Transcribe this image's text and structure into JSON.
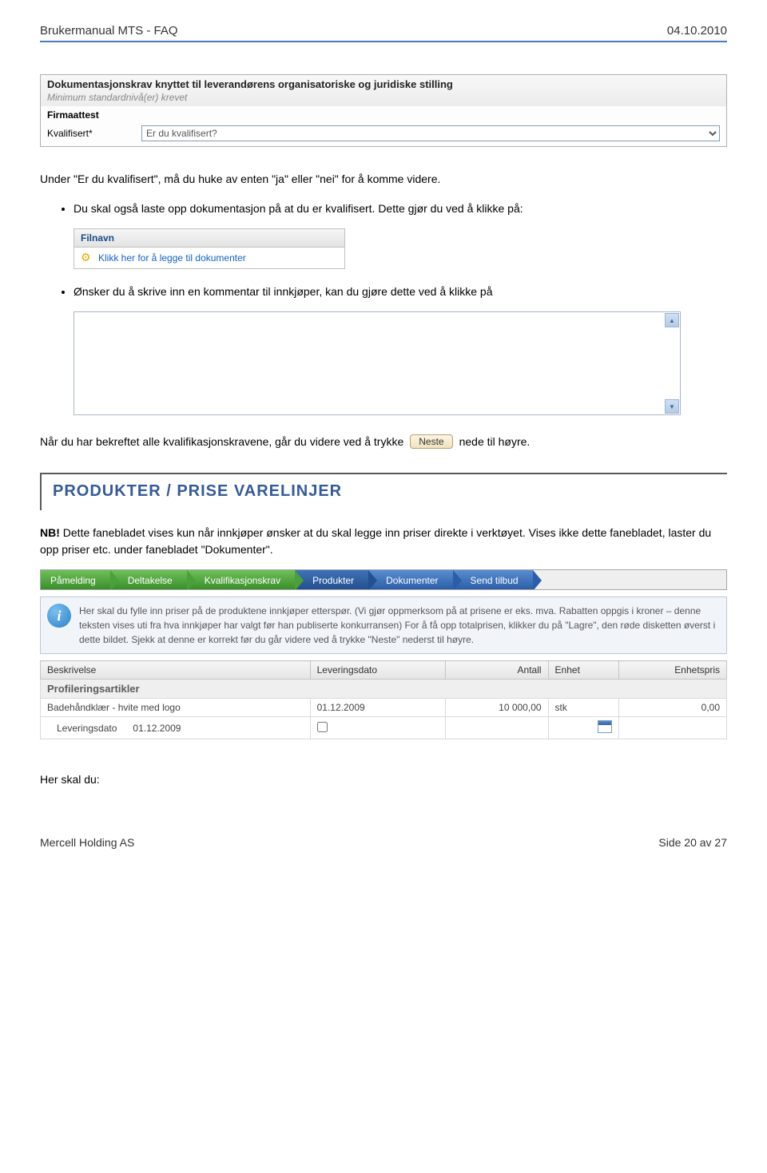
{
  "header": {
    "left": "Brukermanual MTS - FAQ",
    "right": "04.10.2010"
  },
  "form1": {
    "title": "Dokumentasjonskrav knyttet til leverandørens organisatoriske og juridiske stilling",
    "subtitle": "Minimum standardnivå(er) krevet",
    "firm_label": "Firmaattest",
    "qual_label": "Kvalifisert",
    "asterisk": "*",
    "select_placeholder": "Er du kvalifisert?"
  },
  "para1": "Under \"Er du kvalifisert\", må du huke av enten \"ja\" eller \"nei\" for å komme videre.",
  "bullet1": "Du skal også laste opp dokumentasjon på at du er kvalifisert. Dette gjør du ved å klikke på:",
  "file_panel": {
    "header": "Filnavn",
    "link": "Klikk her for å legge til dokumenter"
  },
  "bullet2": "Ønsker du å skrive inn en kommentar til innkjøper, kan du gjøre dette ved å klikke på",
  "confirm_pre": "Når du har bekreftet alle kvalifikasjonskravene, går du videre ved å trykke",
  "neste_label": "Neste",
  "confirm_post": "nede til høyre.",
  "section": {
    "title": "PRODUKTER / PRISE VARELINJER",
    "nb": "NB!",
    "note": " Dette fanebladet vises kun når innkjøper ønsker at du skal legge inn priser direkte i verktøyet. Vises ikke dette fanebladet, laster du opp priser etc. under fanebladet \"Dokumenter\"."
  },
  "chevrons": [
    "Påmelding",
    "Deltakelse",
    "Kvalifikasjonskrav",
    "Produkter",
    "Dokumenter",
    "Send tilbud"
  ],
  "info_text": "Her skal du fylle inn priser på de produktene innkjøper etterspør. (Vi gjør oppmerksom på at prisene er eks. mva. Rabatten oppgis i kroner – denne teksten vises uti fra hva innkjøper har valgt før han publiserte konkurransen) For å få opp totalprisen, klikker du på \"Lagre\", den røde disketten øverst i dette bildet. Sjekk at denne er korrekt før du går videre ved å trykke \"Neste\" nederst til høyre.",
  "grid": {
    "cols": [
      "Beskrivelse",
      "Leveringsdato",
      "Antall",
      "Enhet",
      "Enhetspris"
    ],
    "category": "Profileringsartikler",
    "row": {
      "desc": "Badehåndklær - hvite med logo",
      "date": "01.12.2009",
      "qty": "10 000,00",
      "unit": "stk",
      "price": "0,00"
    },
    "sub": {
      "label": "Leveringsdato",
      "date": "01.12.2009"
    }
  },
  "closing": "Her skal du:",
  "footer": {
    "left": "Mercell Holding AS",
    "right": "Side 20 av 27"
  }
}
